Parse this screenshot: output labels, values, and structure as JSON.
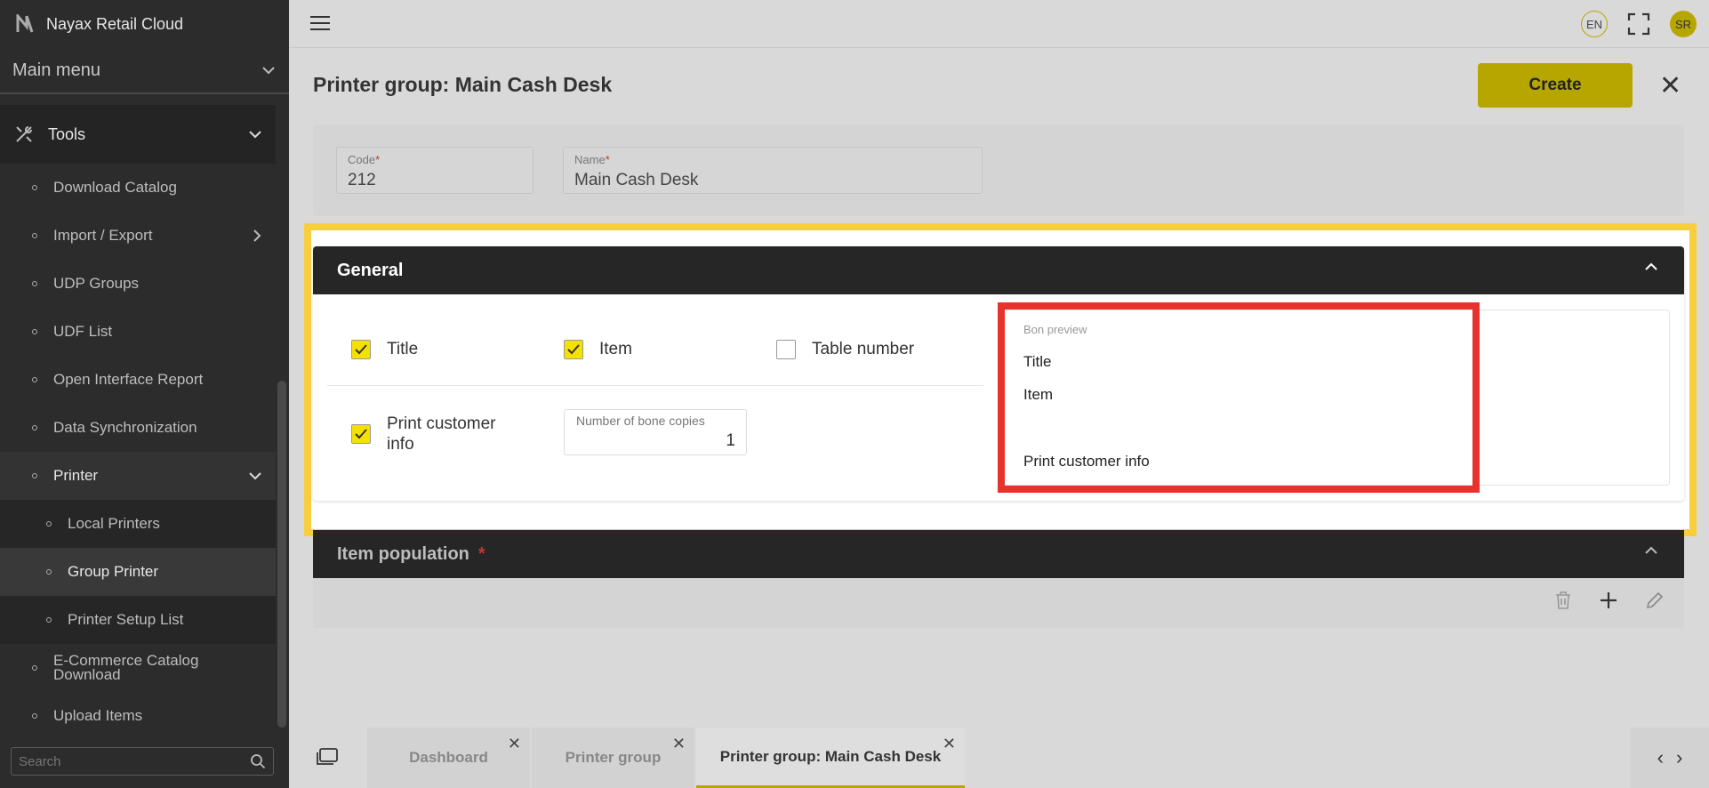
{
  "app": {
    "title": "Nayax Retail Cloud"
  },
  "sidebar": {
    "main_menu": "Main menu",
    "tools": "Tools",
    "items": [
      {
        "label": "Download Catalog"
      },
      {
        "label": "Import / Export"
      },
      {
        "label": "UDP Groups"
      },
      {
        "label": "UDF List"
      },
      {
        "label": "Open Interface Report"
      },
      {
        "label": "Data Synchronization"
      },
      {
        "label": "Printer"
      },
      {
        "label": "Local Printers"
      },
      {
        "label": "Group Printer"
      },
      {
        "label": "Printer Setup List"
      },
      {
        "label": "E-Commerce Catalog Download"
      },
      {
        "label": "Upload Items"
      }
    ],
    "search_placeholder": "Search"
  },
  "topbar": {
    "lang": "EN",
    "avatar": "SR"
  },
  "page": {
    "title": "Printer group: Main Cash Desk",
    "create_label": "Create",
    "code_label": "Code",
    "code_value": "212",
    "name_label": "Name",
    "name_value": "Main Cash Desk",
    "required_mark": "*"
  },
  "general": {
    "header": "General",
    "title_cb": {
      "label": "Title",
      "checked": true
    },
    "item_cb": {
      "label": "Item",
      "checked": true
    },
    "table_cb": {
      "label": "Table number",
      "checked": false
    },
    "customer_cb": {
      "label": "Print customer info",
      "checked": true
    },
    "copies_label": "Number of bone copies",
    "copies_value": "1",
    "preview_label": "Bon preview",
    "preview_lines": [
      "Title",
      "Item",
      "Print customer info"
    ]
  },
  "item_population": {
    "header": "Item population",
    "required_mark": "*"
  },
  "tabs": [
    {
      "label": "Dashboard"
    },
    {
      "label": "Printer group"
    },
    {
      "label": "Printer group: Main Cash Desk"
    }
  ],
  "colors": {
    "accent": "#b8a600",
    "highlight_yellow": "#f7cf3e",
    "highlight_red": "#e8322c",
    "sidebar_bg": "#2c2c2c"
  }
}
